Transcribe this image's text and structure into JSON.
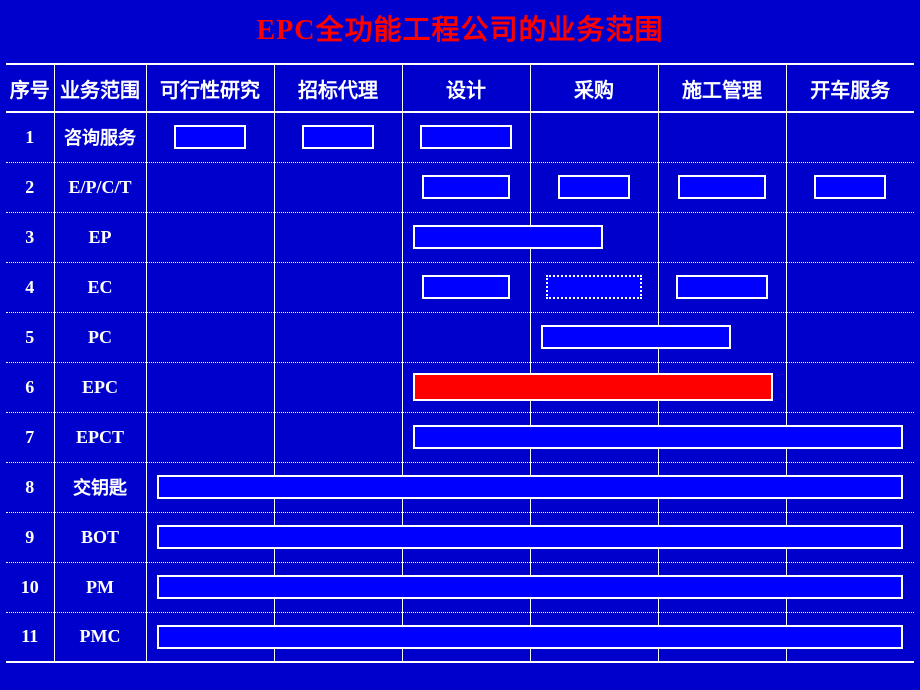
{
  "title": "EPC全功能工程公司的业务范围",
  "headers": {
    "seq": "序号",
    "scope": "业务范围",
    "feasibility": "可行性研究",
    "bidding": "招标代理",
    "design": "设计",
    "procurement": "采购",
    "construction": "施工管理",
    "commissioning": "开车服务"
  },
  "rows": [
    {
      "seq": "1",
      "scope": "咨询服务"
    },
    {
      "seq": "2",
      "scope": "E/P/C/T"
    },
    {
      "seq": "3",
      "scope": "EP"
    },
    {
      "seq": "4",
      "scope": "EC"
    },
    {
      "seq": "5",
      "scope": "PC"
    },
    {
      "seq": "6",
      "scope": "EPC"
    },
    {
      "seq": "7",
      "scope": "EPCT"
    },
    {
      "seq": "8",
      "scope": "交钥匙"
    },
    {
      "seq": "9",
      "scope": "BOT"
    },
    {
      "seq": "10",
      "scope": "PM"
    },
    {
      "seq": "11",
      "scope": "PMC"
    }
  ],
  "chart_data": {
    "type": "table",
    "title": "EPC全功能工程公司的业务范围",
    "phases": [
      "可行性研究",
      "招标代理",
      "设计",
      "采购",
      "施工管理",
      "开车服务"
    ],
    "business_scopes": [
      {
        "no": 1,
        "name": "咨询服务",
        "covers": [
          "可行性研究",
          "招标代理",
          "设计"
        ]
      },
      {
        "no": 2,
        "name": "E/P/C/T",
        "covers": [
          "设计",
          "采购",
          "施工管理",
          "开车服务"
        ]
      },
      {
        "no": 3,
        "name": "EP",
        "covers": [
          "设计",
          "采购"
        ]
      },
      {
        "no": 4,
        "name": "EC",
        "covers": [
          "设计",
          "施工管理"
        ],
        "partial": [
          "采购"
        ]
      },
      {
        "no": 5,
        "name": "PC",
        "covers": [
          "采购",
          "施工管理"
        ]
      },
      {
        "no": 6,
        "name": "EPC",
        "covers": [
          "设计",
          "采购",
          "施工管理"
        ],
        "highlight": true
      },
      {
        "no": 7,
        "name": "EPCT",
        "covers": [
          "设计",
          "采购",
          "施工管理",
          "开车服务"
        ]
      },
      {
        "no": 8,
        "name": "交钥匙",
        "covers": [
          "可行性研究",
          "招标代理",
          "设计",
          "采购",
          "施工管理",
          "开车服务"
        ]
      },
      {
        "no": 9,
        "name": "BOT",
        "covers": [
          "可行性研究",
          "招标代理",
          "设计",
          "采购",
          "施工管理",
          "开车服务"
        ]
      },
      {
        "no": 10,
        "name": "PM",
        "covers": [
          "可行性研究",
          "招标代理",
          "设计",
          "采购",
          "施工管理",
          "开车服务"
        ]
      },
      {
        "no": 11,
        "name": "PMC",
        "covers": [
          "可行性研究",
          "招标代理",
          "设计",
          "采购",
          "施工管理",
          "开车服务"
        ]
      }
    ]
  }
}
